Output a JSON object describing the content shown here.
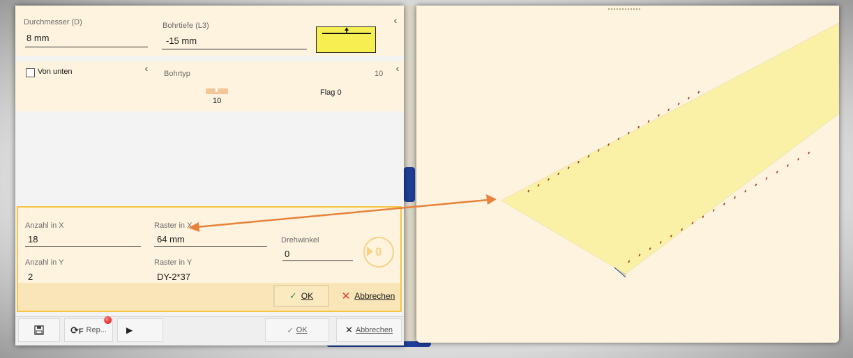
{
  "panel_top": {
    "durchmesser_label": "Durchmesser (D)",
    "durchmesser_value": "8 mm",
    "bohrtiefe_label": "Bohrtiefe (L3)",
    "bohrtiefe_value": "-15 mm"
  },
  "panel_mid": {
    "von_unten_label": "Von unten",
    "bohrtyp_label": "Bohrtyp",
    "bohrtyp_count": "10",
    "bohrtyp_bar_value": "10",
    "flag_label": "Flag 0"
  },
  "pattern": {
    "anzahl_x_label": "Anzahl in X",
    "anzahl_x_value": "18",
    "raster_x_label": "Raster in X",
    "raster_x_value": "64 mm",
    "drehwinkel_label": "Drehwinkel",
    "drehwinkel_value": "0",
    "rotate_button_value": "0",
    "anzahl_y_label": "Anzahl in Y",
    "anzahl_y_value": "2",
    "raster_y_label": "Raster in Y",
    "raster_y_value": "DY-2*37",
    "ok_label": "OK",
    "cancel_label": "Abbrechen"
  },
  "footer": {
    "rep_label": "Rep...",
    "f_label": "F",
    "ok_label": "OK",
    "cancel_label": "Abbrechen"
  },
  "colors": {
    "panel_bg": "#fdf3de",
    "highlight_border": "#f5c542",
    "board": "#fbf1a6",
    "arrow": "#e8823a",
    "cancel_x": "#d9363e",
    "ok_check": "#2e8b57"
  },
  "icons": [
    "chevron-left-icon",
    "checkbox-icon",
    "save-icon",
    "rotate-f-icon",
    "play-icon",
    "check-icon",
    "close-icon",
    "rotate-circle-icon"
  ]
}
